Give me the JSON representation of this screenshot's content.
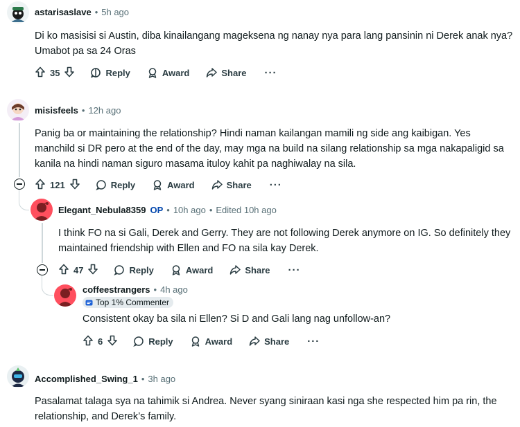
{
  "comments": [
    {
      "user": "astarisaslave",
      "time": "5h ago",
      "text": "Di ko masisisi si Austin, diba kinailangang mageksena ng nanay nya para lang pansinin ni Derek anak nya? Umabot pa sa 24 Oras",
      "votes": "35"
    },
    {
      "user": "misisfeels",
      "time": "12h ago",
      "text": "Panig ba or maintaining the relationship? Hindi naman kailangan mamili ng side ang kaibigan. Yes manchild si DR pero at the end of the day, may mga na build na silang relationship sa mga nakapaligid sa kanila na hindi naman siguro masama ituloy kahit pa naghiwalay na sila.",
      "votes": "121"
    },
    {
      "user": "Elegant_Nebula8359",
      "op": "OP",
      "time": "10h ago",
      "edited": "Edited 10h ago",
      "text": "I think FO na si Gali, Derek and Gerry. They are not following Derek anymore on IG. So definitely they maintained friendship with Ellen and FO na sila kay Derek.",
      "votes": "47"
    },
    {
      "user": "coffeestrangers",
      "time": "4h ago",
      "badge": "Top 1% Commenter",
      "text": "Consistent okay ba sila ni Ellen? Si D and Gali lang nag unfollow-an?",
      "votes": "6"
    },
    {
      "user": "Accomplished_Swing_1",
      "time": "3h ago",
      "text": "Pasalamat talaga sya na tahimik si Andrea. Never syang siniraan kasi nga she respected him pa rin, the relationship, and Derek’s family."
    }
  ],
  "actions": {
    "reply": "Reply",
    "award": "Award",
    "share": "Share",
    "more": "···"
  },
  "separator": "•",
  "icons": [
    "upvote-icon",
    "downvote-icon",
    "reply-icon",
    "award-icon",
    "share-icon",
    "collapse-icon"
  ],
  "colors": {
    "op": "#0045ac",
    "meta": "#576f76",
    "thread_line": "#cfd8db",
    "badge_bg": "#e5ebee"
  }
}
